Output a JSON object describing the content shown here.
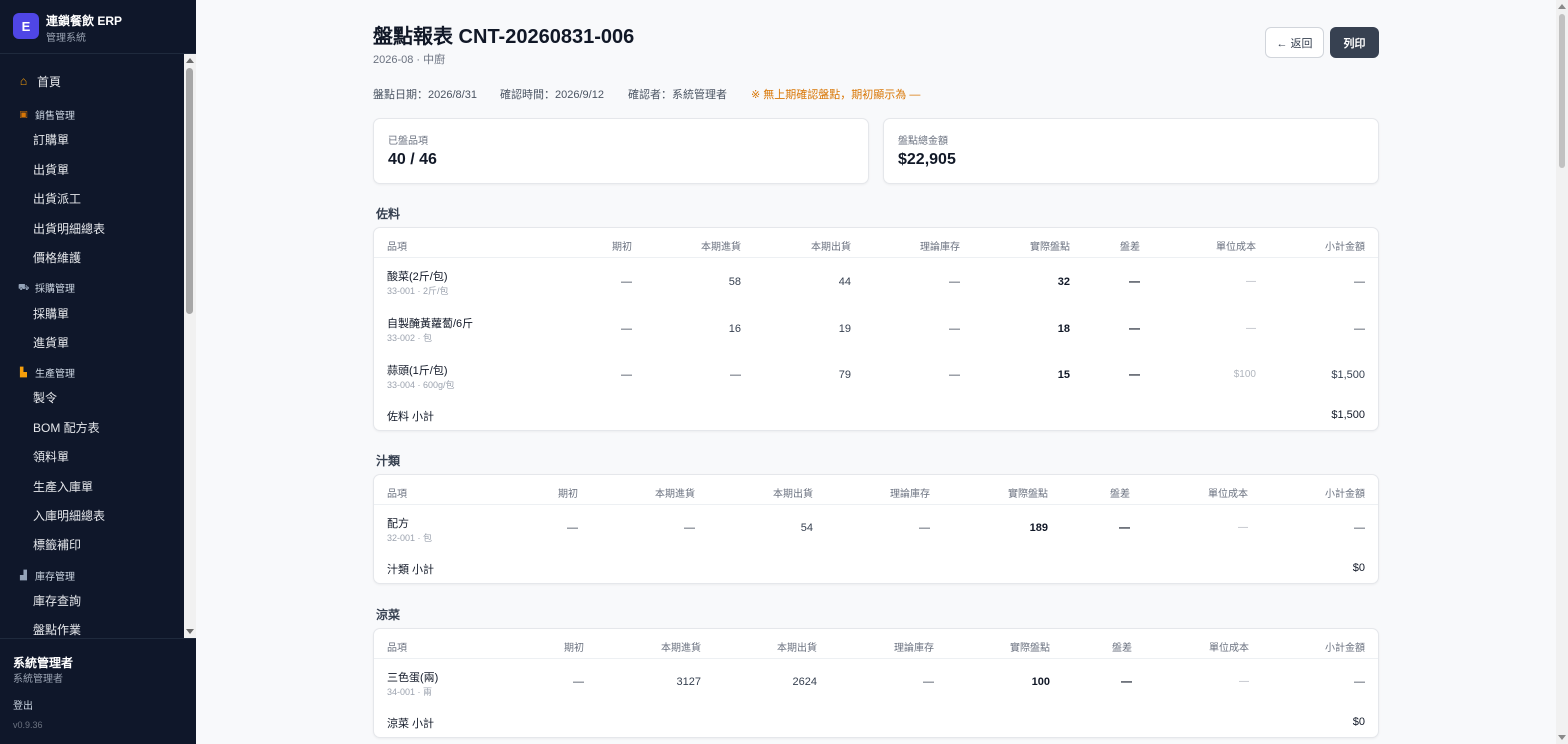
{
  "brand": {
    "logo": "E",
    "name": "連鎖餐飲 ERP",
    "subtitle": "管理系統"
  },
  "nav": {
    "home": {
      "label": "首頁",
      "icon": "home-icon"
    },
    "groups": [
      {
        "label": "銷售管理",
        "icon": "box-icon",
        "items": [
          "訂購單",
          "出貨單",
          "出貨派工",
          "出貨明細總表",
          "價格維護"
        ]
      },
      {
        "label": "採購管理",
        "icon": "cart-icon",
        "items": [
          "採購單",
          "進貨單"
        ]
      },
      {
        "label": "生產管理",
        "icon": "factory-icon",
        "items": [
          "製令",
          "BOM 配方表",
          "領料單",
          "生產入庫單",
          "入庫明細總表",
          "標籤補印"
        ]
      },
      {
        "label": "庫存管理",
        "icon": "warehouse-icon",
        "items": [
          "庫存查詢",
          "盤點作業"
        ]
      }
    ]
  },
  "user": {
    "name": "系統管理者",
    "role": "系統管理者",
    "logout": "登出",
    "version": "v0.9.36"
  },
  "header": {
    "title": "盤點報表 CNT-20260831-006",
    "subtitle": "2026-08 · 中廚",
    "back_label": "← 返回",
    "print_label": "列印"
  },
  "meta": {
    "count_date": "盤點日期：2026/8/31",
    "confirm_time": "確認時間：2026/9/12",
    "confirmer": "確認者：系統管理者",
    "warning": "※ 無上期確認盤點，期初顯示為 —"
  },
  "summary": {
    "counted_label": "已盤品項",
    "counted_value": "40 / 46",
    "total_label": "盤點總金額",
    "total_value": "$22,905"
  },
  "columns": [
    "品項",
    "期初",
    "本期進貨",
    "本期出貨",
    "理論庫存",
    "實際盤點",
    "盤差",
    "單位成本",
    "小計金額"
  ],
  "sections": [
    {
      "title": "佐料",
      "rows": [
        {
          "name": "酸菜(2斤/包)",
          "code": "33-001 · 2斤/包",
          "opening": "—",
          "purchased": "58",
          "shipped": "44",
          "theoretical": "—",
          "actual": "32",
          "diff": "—",
          "unit_cost": "—",
          "subtotal": "—"
        },
        {
          "name": "自製醃黃蘿蔔/6斤",
          "code": "33-002 · 包",
          "opening": "—",
          "purchased": "16",
          "shipped": "19",
          "theoretical": "—",
          "actual": "18",
          "diff": "—",
          "unit_cost": "—",
          "subtotal": "—"
        },
        {
          "name": "蒜頭(1斤/包)",
          "code": "33-004 · 600g/包",
          "opening": "—",
          "purchased": "—",
          "shipped": "79",
          "theoretical": "—",
          "actual": "15",
          "diff": "—",
          "unit_cost": "$100",
          "subtotal": "$1,500"
        }
      ],
      "subtotal_label": "佐料 小計",
      "subtotal_value": "$1,500"
    },
    {
      "title": "汁類",
      "rows": [
        {
          "name": "配方",
          "code": "32-001 · 包",
          "opening": "—",
          "purchased": "—",
          "shipped": "54",
          "theoretical": "—",
          "actual": "189",
          "diff": "—",
          "unit_cost": "—",
          "subtotal": "—"
        }
      ],
      "subtotal_label": "汁類 小計",
      "subtotal_value": "$0"
    },
    {
      "title": "涼菜",
      "rows": [
        {
          "name": "三色蛋(兩)",
          "code": "34-001 · 兩",
          "opening": "—",
          "purchased": "3127",
          "shipped": "2624",
          "theoretical": "—",
          "actual": "100",
          "diff": "—",
          "unit_cost": "—",
          "subtotal": "—"
        }
      ],
      "subtotal_label": "涼菜 小計",
      "subtotal_value": "$0"
    }
  ],
  "colors": {
    "sidebar_bg": "#0f172a",
    "brand_accent": "#4f46e5",
    "warning": "#d97706",
    "print_button": "#374151"
  }
}
